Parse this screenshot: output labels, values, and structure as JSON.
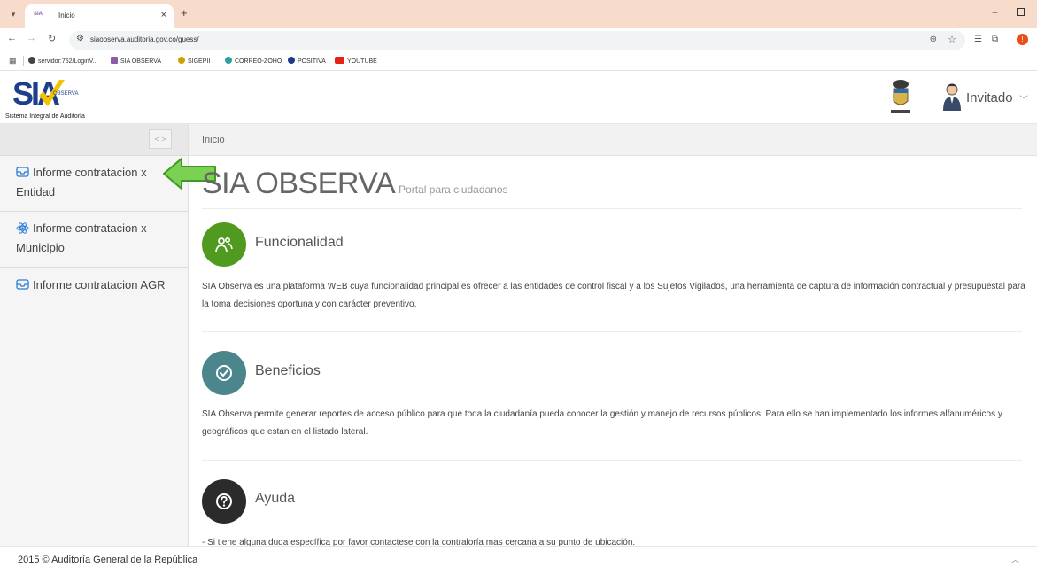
{
  "browser": {
    "tab_title": "Inicio",
    "tab_favicon": "SIA",
    "tab_close": "×",
    "new_tab": "+",
    "url": "siaobserva.auditoria.gov.co/guess/",
    "profile_initial": "!",
    "bookmarks": [
      {
        "label": "servidor:752/LoginV...",
        "icon": "globe-icon",
        "color": "#444444"
      },
      {
        "label": "SIA OBSERVA",
        "icon": "sia-favicon",
        "color": "#8e5ba8"
      },
      {
        "label": "SIGEPII",
        "icon": "sigep-icon",
        "color": "#c9a400"
      },
      {
        "label": "CORREO-ZOHO",
        "icon": "mail-icon",
        "color": "#2aa0a0"
      },
      {
        "label": "POSITIVA",
        "icon": "positiva-icon",
        "color": "#1a3a8a"
      },
      {
        "label": "YOUTUBE",
        "icon": "youtube-icon",
        "color": "#e62117"
      }
    ]
  },
  "header": {
    "logo_main": "SIA",
    "logo_sub": "OBSERVA",
    "logo_tagline": "Sistema Integral de Auditoría",
    "user_name": "Invitado"
  },
  "sidebar": {
    "items": [
      {
        "line1": "Informe contratacion x",
        "line2": "Entidad",
        "icon": "inbox-icon"
      },
      {
        "line1": "Informe contratacion x",
        "line2": "Municipio",
        "icon": "atom-icon"
      },
      {
        "line1": "Informe contratacion AGR",
        "line2": "",
        "icon": "inbox-icon"
      }
    ]
  },
  "main": {
    "breadcrumb": "Inicio",
    "title": "SIA OBSERVA",
    "subtitle": "Portal para ciudadanos",
    "sections": [
      {
        "title": "Funcionalidad",
        "icon": "users-icon",
        "color": "#4f9a1f",
        "text": "SIA Observa es una plataforma WEB cuya funcionalidad principal es ofrecer a las entidades de control fiscal y a los Sujetos Vigilados, una herramienta de captura de información contractual y presupuestal para la toma decisiones oportuna y con carácter preventivo."
      },
      {
        "title": "Beneficios",
        "icon": "check-circle-icon",
        "color": "#4a868c",
        "text": "SIA Observa permite generar reportes de acceso público para que toda la ciudadanía pueda conocer la gestión y manejo de recursos públicos. Para ello se han implementado los informes alfanuméricos y geográficos que estan en el listado lateral."
      },
      {
        "title": "Ayuda",
        "icon": "question-circle-icon",
        "color": "#2b2b2b",
        "text": "- Si tiene alguna duda específica por favor contactese con la contraloría mas cercana a su punto de ubicación."
      }
    ]
  },
  "footer": {
    "text": "2015 © Auditoría General de la República"
  },
  "colors": {
    "tabbar": "#f7dccb",
    "logo_blue": "#1d3e8a",
    "logo_yellow": "#f2c300",
    "arrow_green": "#7bd152",
    "sidebar_icon": "#2b7bd6"
  }
}
